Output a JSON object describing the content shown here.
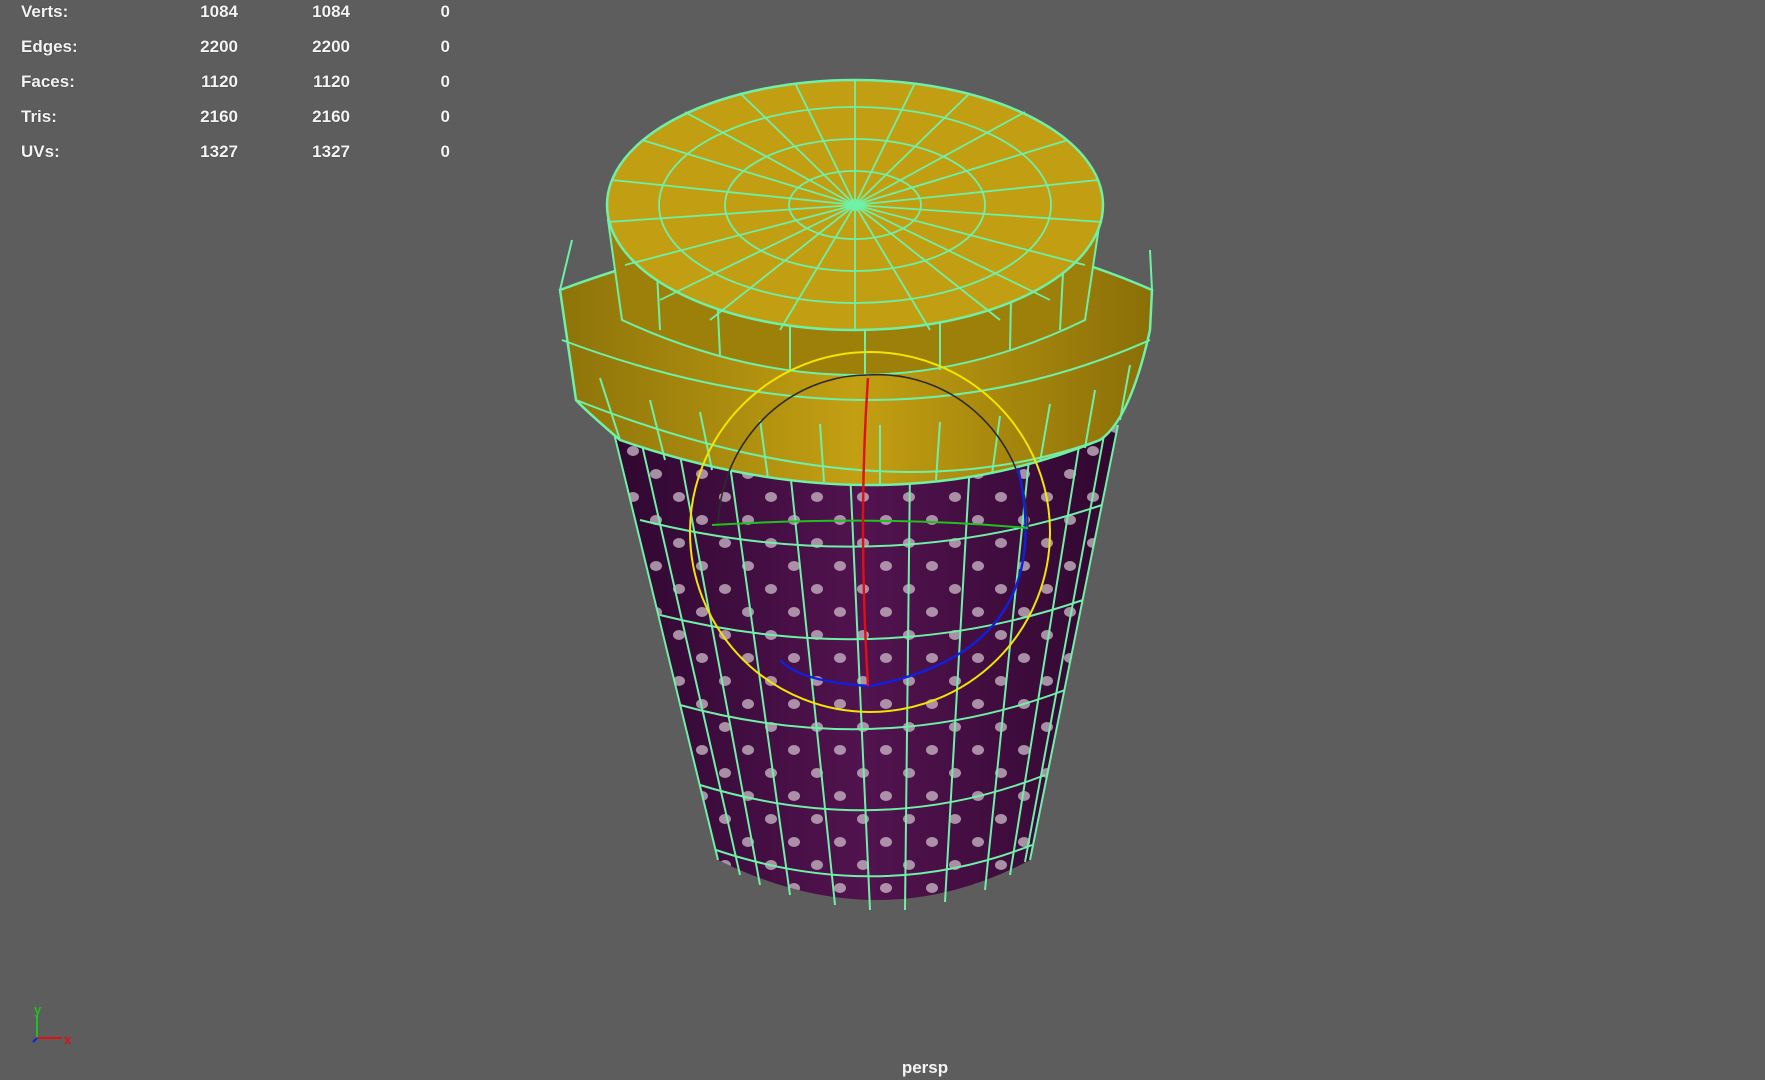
{
  "hud": {
    "rows": [
      {
        "label": "Verts:",
        "v1": "1084",
        "v2": "1084",
        "v3": "0"
      },
      {
        "label": "Edges:",
        "v1": "2200",
        "v2": "2200",
        "v3": "0"
      },
      {
        "label": "Faces:",
        "v1": "1120",
        "v2": "1120",
        "v3": "0"
      },
      {
        "label": "Tris:",
        "v1": "2160",
        "v2": "2160",
        "v3": "0"
      },
      {
        "label": "UVs:",
        "v1": "1327",
        "v2": "1327",
        "v3": "0"
      }
    ]
  },
  "viewport": {
    "camera": "persp",
    "background_color": "#5d5d5d"
  },
  "axis_gizmo": {
    "y_label": "y",
    "x_label": "x"
  },
  "colors": {
    "wireframe": "#6ff0a6",
    "lid": "#b8960c",
    "cup_body": "#4a0f4c",
    "gizmo_outer": "#f2e600",
    "gizmo_x": "#e01010",
    "gizmo_z": "#1020e0",
    "gizmo_y": "#20c020"
  }
}
